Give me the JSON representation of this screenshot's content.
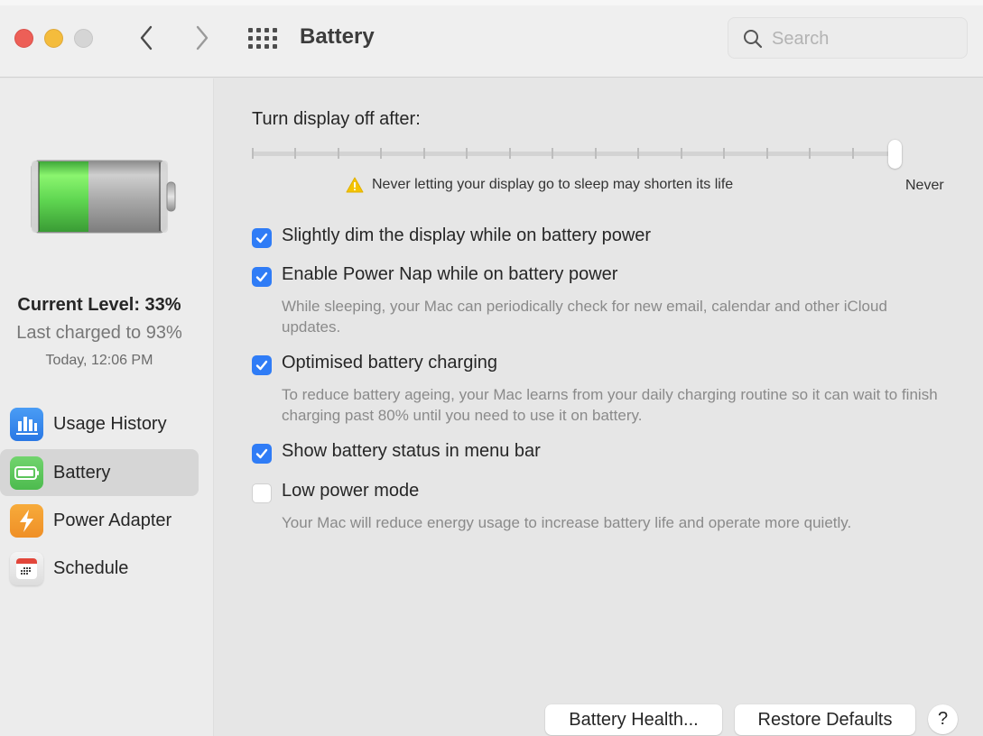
{
  "window": {
    "title": "Battery",
    "search": {
      "placeholder": "Search",
      "value": ""
    }
  },
  "sidebar": {
    "battery_status": {
      "current_level": "Current Level: 33%",
      "current_level_fraction": 0.33,
      "last_charged": "Last charged to 93%",
      "last_charged_time": "Today, 12:06 PM"
    },
    "items": [
      {
        "label": "Usage History",
        "icon": "usage-history-icon",
        "selected": false
      },
      {
        "label": "Battery",
        "icon": "battery-icon",
        "selected": true
      },
      {
        "label": "Power Adapter",
        "icon": "power-adapter-icon",
        "selected": false
      },
      {
        "label": "Schedule",
        "icon": "schedule-icon",
        "selected": false
      }
    ]
  },
  "main": {
    "display_off": {
      "label": "Turn display off after:",
      "tick_count": 16,
      "selected_index": 15,
      "value_label": "Never",
      "warning": "Never letting your display go to sleep may shorten its life"
    },
    "options": [
      {
        "label": "Slightly dim the display while on battery power",
        "checked": true,
        "description": ""
      },
      {
        "label": "Enable Power Nap while on battery power",
        "checked": true,
        "description": "While sleeping, your Mac can periodically check for new email, calendar and other iCloud updates."
      },
      {
        "label": "Optimised battery charging",
        "checked": true,
        "description": "To reduce battery ageing, your Mac learns from your daily charging routine so it can wait to finish charging past 80% until you need to use it on battery."
      },
      {
        "label": "Show battery status in menu bar",
        "checked": true,
        "description": ""
      },
      {
        "label": "Low power mode",
        "checked": false,
        "description": "Your Mac will reduce energy usage to increase battery life and operate more quietly."
      }
    ],
    "buttons": {
      "battery_health": "Battery Health...",
      "restore_defaults": "Restore Defaults",
      "help": "?"
    }
  },
  "colors": {
    "accent": "#2f7cf6",
    "battery_green": "#5fd651",
    "close": "#ed5f57",
    "minimize": "#f4bc3c",
    "warning": "#f5c400"
  }
}
